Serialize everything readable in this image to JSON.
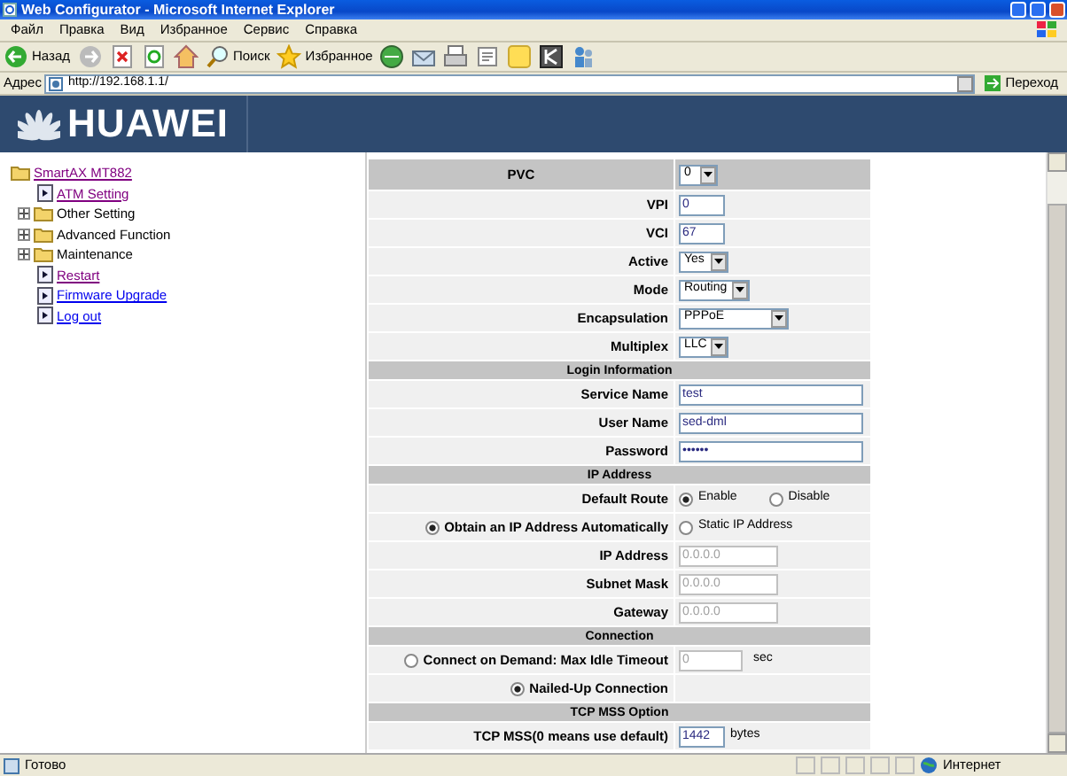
{
  "window": {
    "title": "Web Configurator - Microsoft Internet Explorer"
  },
  "menu": [
    "Файл",
    "Правка",
    "Вид",
    "Избранное",
    "Сервис",
    "Справка"
  ],
  "toolbar": [
    {
      "kind": "back",
      "label": "Назад"
    },
    {
      "kind": "forward"
    },
    {
      "kind": "stop"
    },
    {
      "kind": "refresh"
    },
    {
      "kind": "home"
    },
    {
      "kind": "search",
      "label": "Поиск"
    },
    {
      "kind": "favorites",
      "label": "Избранное"
    },
    {
      "kind": "media"
    },
    {
      "kind": "mail"
    },
    {
      "kind": "print"
    },
    {
      "kind": "edit"
    },
    {
      "kind": "note"
    },
    {
      "kind": "k"
    },
    {
      "kind": "messenger"
    }
  ],
  "address": {
    "label": "Адрес",
    "url": "http://192.168.1.1/",
    "go": "Переход"
  },
  "banner": {
    "brand": "HUAWEI"
  },
  "tree": {
    "label": "SmartAX MT882",
    "kind": "folder",
    "visited": true,
    "children": [
      {
        "label": "ATM Setting",
        "kind": "page",
        "visited": true
      },
      {
        "label": "Other Setting",
        "kind": "folder",
        "expanded": false
      },
      {
        "label": "Advanced Function",
        "kind": "folder",
        "expanded": false
      },
      {
        "label": "Maintenance",
        "kind": "folder",
        "expanded": false
      },
      {
        "label": "Restart",
        "kind": "page",
        "visited": true
      },
      {
        "label": "Firmware Upgrade",
        "kind": "page",
        "visited": false
      },
      {
        "label": "Log out",
        "kind": "page",
        "visited": false
      }
    ]
  },
  "form": {
    "rows": [
      {
        "kind": "pvc",
        "label": "PVC",
        "value": "0"
      },
      {
        "kind": "input",
        "label": "VPI",
        "value": "0",
        "disabled": false
      },
      {
        "kind": "input",
        "label": "VCI",
        "value": "67",
        "disabled": false
      },
      {
        "kind": "select",
        "label": "Active",
        "value": "Yes"
      },
      {
        "kind": "select",
        "label": "Mode",
        "value": "Routing"
      },
      {
        "kind": "select",
        "label": "Encapsulation",
        "value": "PPPoE"
      },
      {
        "kind": "select",
        "label": "Multiplex",
        "value": "LLC"
      },
      {
        "kind": "header",
        "label": "Login Information"
      },
      {
        "kind": "input",
        "label": "Service Name",
        "value": "test",
        "disabled": false
      },
      {
        "kind": "input",
        "label": "User Name",
        "value": "sed-dml",
        "disabled": false
      },
      {
        "kind": "input",
        "label": "Password",
        "value": "••••••",
        "disabled": false
      },
      {
        "kind": "header",
        "label": "IP Address"
      },
      {
        "kind": "radio_pair",
        "label": "Default Route",
        "options": [
          {
            "label": "Enable",
            "selected": true
          },
          {
            "label": "Disable",
            "selected": false
          }
        ]
      },
      {
        "kind": "radio_split",
        "options": [
          {
            "label": "Obtain an IP Address Automatically",
            "selected": true
          },
          {
            "label": "Static IP Address",
            "selected": false
          }
        ]
      },
      {
        "kind": "input",
        "label": "IP Address",
        "value": "0.0.0.0",
        "disabled": true
      },
      {
        "kind": "input",
        "label": "Subnet Mask",
        "value": "0.0.0.0",
        "disabled": true
      },
      {
        "kind": "input",
        "label": "Gateway",
        "value": "0.0.0.0",
        "disabled": true
      },
      {
        "kind": "header",
        "label": "Connection"
      },
      {
        "kind": "radio_input",
        "option": {
          "label": "Connect on Demand: Max Idle Timeout",
          "selected": false
        },
        "value": "0",
        "unit": "sec",
        "disabled": true
      },
      {
        "kind": "radio_only",
        "option": {
          "label": "Nailed-Up Connection",
          "selected": true
        }
      },
      {
        "kind": "header",
        "label": "TCP MSS Option"
      },
      {
        "kind": "input",
        "label": "TCP MSS(0 means use default)",
        "value": "1442",
        "unit": "bytes",
        "disabled": false
      }
    ]
  },
  "status_bar": {
    "text": "Готово",
    "zone": "Интернет"
  }
}
